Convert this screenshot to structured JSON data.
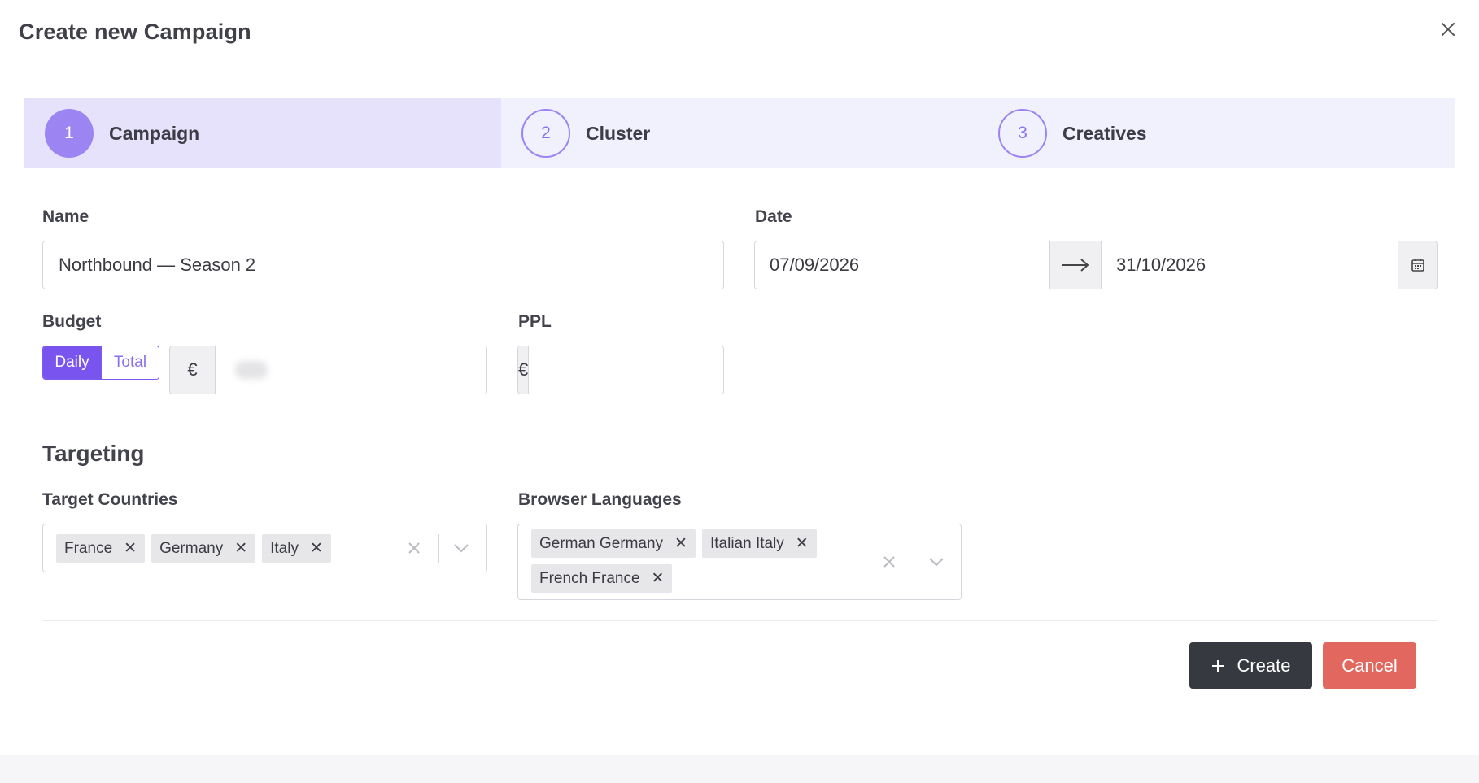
{
  "modal": {
    "title": "Create new Campaign",
    "close_icon": "close-icon"
  },
  "steps": [
    {
      "number": "1",
      "label": "Campaign",
      "active": true
    },
    {
      "number": "2",
      "label": "Cluster",
      "active": false
    },
    {
      "number": "3",
      "label": "Creatives",
      "active": false
    }
  ],
  "form": {
    "name": {
      "label": "Name",
      "value": "Northbound — Season 2"
    },
    "date": {
      "label": "Date",
      "start": "07/09/2026",
      "end": "31/10/2026",
      "arrow_icon": "arrow-right-icon",
      "calendar_icon": "calendar-icon"
    },
    "budget": {
      "label": "Budget",
      "toggle_daily": "Daily",
      "toggle_total": "Total",
      "selected": "Daily",
      "currency": "€",
      "value": ""
    },
    "ppl": {
      "label": "PPL",
      "currency": "€",
      "value": ""
    }
  },
  "targeting": {
    "title": "Targeting",
    "countries": {
      "label": "Target Countries",
      "selected": [
        "France",
        "Germany",
        "Italy"
      ]
    },
    "languages": {
      "label": "Browser Languages",
      "selected": [
        "German Germany",
        "Italian Italy",
        "French France"
      ]
    }
  },
  "actions": {
    "create_label": "Create",
    "create_icon": "plus-icon",
    "cancel_label": "Cancel"
  },
  "colors": {
    "accent": "#7a54ef",
    "step_bg": "#f1f0fd",
    "step_active_bg": "#e6e2fb",
    "create_bg": "#363a40",
    "cancel_bg": "#e2675f"
  }
}
